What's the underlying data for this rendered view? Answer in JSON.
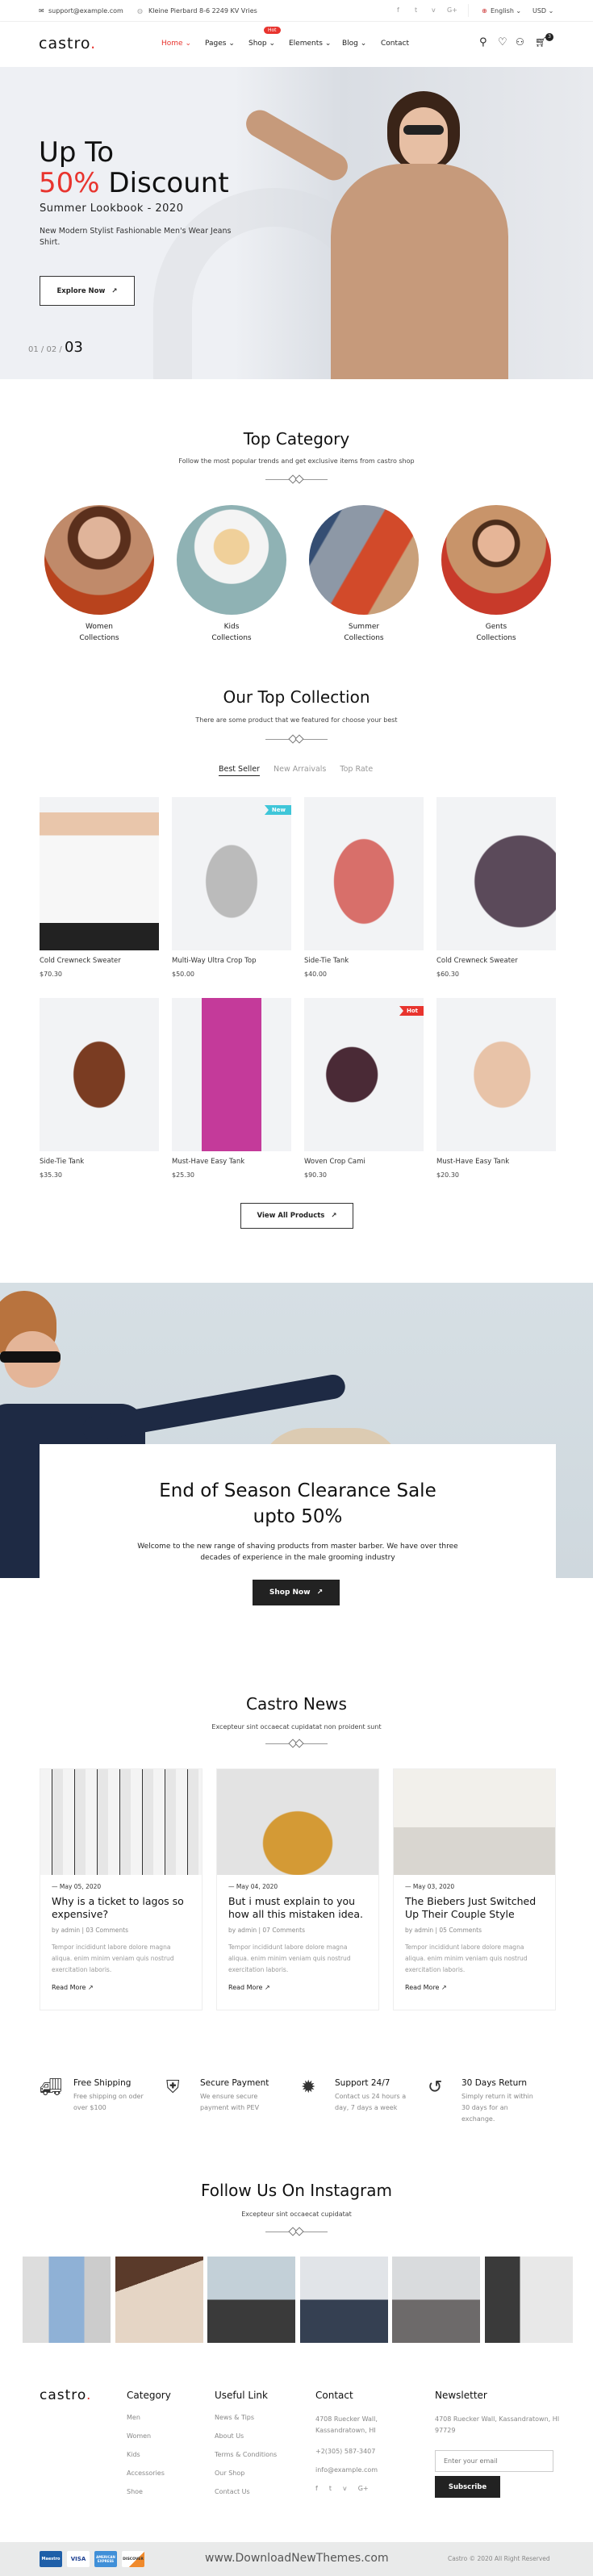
{
  "topbar": {
    "email": "support@example.com",
    "address": "Kleine Pierbard 8-6 2249 KV Vries",
    "social": [
      "f",
      "t",
      "v",
      "G+"
    ],
    "language": "English",
    "currency": "USD"
  },
  "header": {
    "logo": "castro",
    "nav": [
      {
        "label": "Home",
        "active": true
      },
      {
        "label": "Pages"
      },
      {
        "label": "Shop",
        "badge": "Hot"
      },
      {
        "label": "Elements"
      },
      {
        "label": "Blog"
      },
      {
        "label": "Contact"
      }
    ],
    "cart_count": "3"
  },
  "hero": {
    "line1": "Up To",
    "highlight": "50%",
    "line2": " Discount",
    "subtitle": "Summer Lookbook - 2020",
    "text": "New Modern Stylist Fashionable Men's Wear Jeans Shirt.",
    "button": "Explore Now",
    "slides": [
      "01",
      "02",
      "03"
    ],
    "active_slide": "03"
  },
  "category": {
    "title": "Top Category",
    "subtitle": "Follow the most popular trends and get exclusive items from castro shop",
    "items": [
      {
        "name": "Women",
        "sub": "Collections"
      },
      {
        "name": "Kids",
        "sub": "Collections"
      },
      {
        "name": "Summer",
        "sub": "Collections"
      },
      {
        "name": "Gents",
        "sub": "Collections"
      }
    ]
  },
  "collection": {
    "title": "Our Top Collection",
    "subtitle": "There are some product that we featured for choose your best",
    "tabs": [
      "Best Seller",
      "New Arraivals",
      "Top Rate"
    ],
    "active_tab": "Best Seller",
    "products": [
      {
        "name": "Cold Crewneck Sweater",
        "price": "$70.30"
      },
      {
        "name": "Multi-Way Ultra Crop Top",
        "price": "$50.00",
        "badge": "New"
      },
      {
        "name": "Side-Tie Tank",
        "price": "$40.00"
      },
      {
        "name": "Cold Crewneck Sweater",
        "price": "$60.30"
      },
      {
        "name": "Side-Tie Tank",
        "price": "$35.30"
      },
      {
        "name": "Must-Have Easy Tank",
        "price": "$25.30"
      },
      {
        "name": "Woven Crop Cami",
        "price": "$90.30",
        "badge": "Hot"
      },
      {
        "name": "Must-Have Easy Tank",
        "price": "$20.30"
      }
    ],
    "button": "View All Products"
  },
  "sale": {
    "title": "End of Season Clearance Sale",
    "title2": "upto 50%",
    "text": "Welcome to the new range of shaving products from master barber. We have over three decades of experience in the male grooming industry",
    "button": "Shop Now"
  },
  "news": {
    "title": "Castro News",
    "subtitle": "Excepteur sint occaecat cupidatat non proident sunt",
    "posts": [
      {
        "date": "May 05, 2020",
        "title": "Why is a ticket to lagos so expensive?",
        "author": "by admin",
        "comments": "03 Comments",
        "excerpt": "Tempor incididunt labore dolore magna aliqua. enim minim veniam quis nostrud exercitation laboris.",
        "link": "Read More"
      },
      {
        "date": "May 04, 2020",
        "title": "But i must explain to you how all this mistaken idea.",
        "author": "by admin",
        "comments": "07 Comments",
        "excerpt": "Tempor incididunt labore dolore magna aliqua. enim minim veniam quis nostrud exercitation laboris.",
        "link": "Read More"
      },
      {
        "date": "May 03, 2020",
        "title": "The Biebers Just Switched Up Their Couple Style",
        "author": "by admin",
        "comments": "05 Comments",
        "excerpt": "Tempor incididunt labore dolore magna aliqua. enim minim veniam quis nostrud exercitation laboris.",
        "link": "Read More"
      }
    ]
  },
  "features": [
    {
      "icon": "truck-icon",
      "title": "Free Shipping",
      "text": "Free shipping on oder over $100"
    },
    {
      "icon": "secure-card-icon",
      "title": "Secure Payment",
      "text": "We ensure secure payment with PEV"
    },
    {
      "icon": "support-24-7-icon",
      "title": "Support 24/7",
      "text": "Contact us 24 hours a day, 7 days a week"
    },
    {
      "icon": "return-icon",
      "title": "30 Days Return",
      "text": "Simply return it within 30 days for an exchange."
    }
  ],
  "instagram": {
    "title": "Follow Us On Instagram",
    "subtitle": "Excepteur sint occaecat cupidatat"
  },
  "footer": {
    "logo": "castro",
    "category": {
      "title": "Category",
      "links": [
        "Men",
        "Women",
        "Kids",
        "Accessories",
        "Shoe"
      ]
    },
    "useful": {
      "title": "Useful Link",
      "links": [
        "News & Tips",
        "About Us",
        "Terms & Conditions",
        "Our Shop",
        "Contact Us"
      ]
    },
    "contact": {
      "title": "Contact",
      "address": "4708 Ruecker Wall, Kassandratown, HI",
      "phone": "+2(305) 587-3407",
      "email": "info@example.com",
      "social": [
        "f",
        "t",
        "v",
        "G+"
      ]
    },
    "newsletter": {
      "title": "Newsletter",
      "address": "4708 Ruecker Wall, Kassandratown, HI 97729",
      "placeholder": "Enter your email",
      "button": "Subscribe"
    },
    "payments": [
      "Maestro",
      "VISA",
      "AMERICAN EXPRESS",
      "DISCOVER"
    ],
    "watermark": "www.DownloadNewThemes.com",
    "copyright": "Castro © 2020 All Right Reserved"
  },
  "colors": {
    "accent": "#e8342e",
    "new_badge": "#3fc6d9",
    "dark": "#222222",
    "hero_bg": "#eef0f4"
  }
}
